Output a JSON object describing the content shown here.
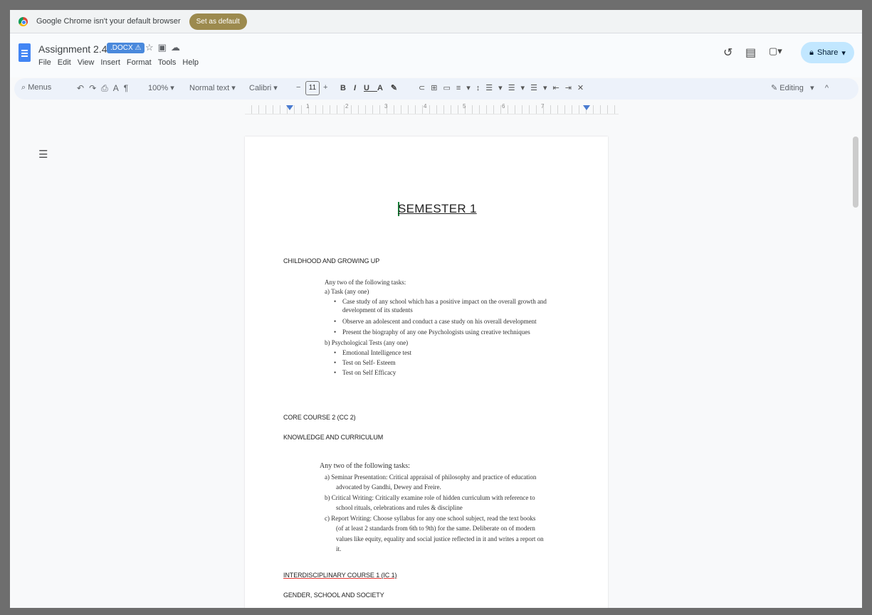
{
  "infobar": {
    "message": "Google Chrome isn't your default browser",
    "set_default": "Set as default"
  },
  "header": {
    "title": "Assignment 2.4.7",
    "badge": ".DOCX",
    "menu": [
      "File",
      "Edit",
      "View",
      "Insert",
      "Format",
      "Tools",
      "Help"
    ],
    "share": "Share"
  },
  "toolbar": {
    "search": "Menus",
    "zoom": "100%",
    "style": "Normal text",
    "font": "Calibri",
    "font_size": "11",
    "mode": "Editing"
  },
  "ruler": [
    "1",
    "2",
    "3",
    "4",
    "5",
    "6",
    "7"
  ],
  "document": {
    "title": "SEMESTER 1",
    "section1": {
      "heading": "CHILDHOOD AND GROWING UP",
      "intro": "Any two of the following tasks:",
      "task_a": "a) Task (any one)",
      "bullets_a": [
        "Case study of any school which has a positive impact on the overall growth and",
        "development of its students",
        "Observe an adolescent and conduct a case study on his overall development",
        "Present the biography of any one Psychologists using creative techniques"
      ],
      "task_b": "b) Psychological Tests (any one)",
      "bullets_b": [
        "Emotional Intelligence test",
        "Test on Self- Esteem",
        "Test on Self Efficacy"
      ]
    },
    "section2": {
      "heading1": "CORE COURSE 2 (CC 2)",
      "heading2": "KNOWLEDGE AND CURRICULUM",
      "intro": "Any two of the following tasks:",
      "lines": [
        "a)  Seminar Presentation: Critical appraisal of philosophy and practice of education",
        "advocated by Gandhi, Dewey and Freire.",
        "b)  Critical  Writing: Critically examine role of hidden curriculum with reference to",
        "school rituals, celebrations and rules & discipline",
        "c)  Report Writing: Choose syllabus for any one school subject, read the text books",
        "(of at least 2 standards from 6th to 9th) for the same. Deliberate on of modern",
        "values like equity, equality and social justice reflected in it and writes a report on",
        "it."
      ]
    },
    "section3": {
      "heading1": "INTERDISCIPLINARY COURSE 1 (IC 1)",
      "heading2": "GENDER, SCHOOL AND SOCIETY"
    }
  }
}
